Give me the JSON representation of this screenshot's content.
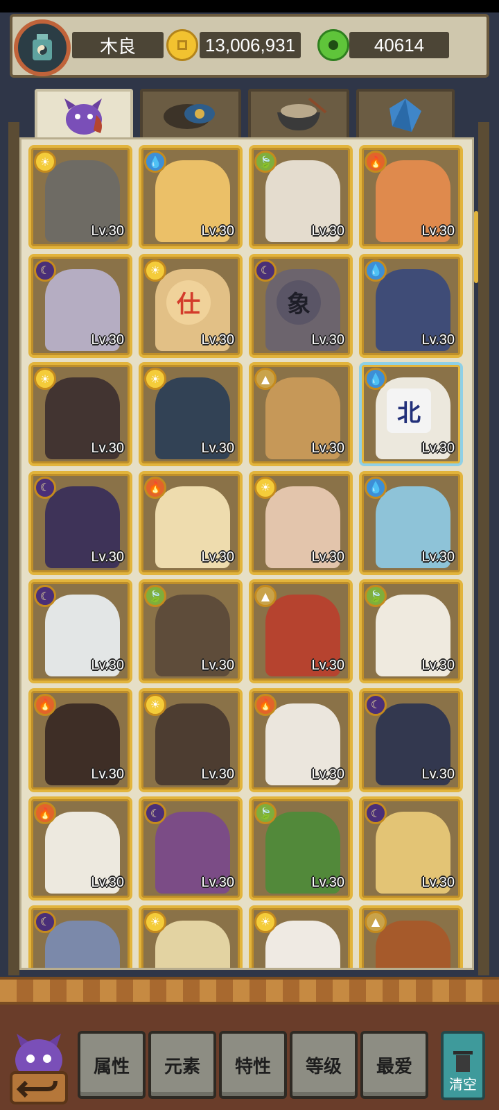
{
  "header": {
    "player_name": "木良",
    "gold": "13,006,931",
    "jade": "40614"
  },
  "tabs": [
    {
      "icon": "demon-icon",
      "active": true
    },
    {
      "icon": "disc-icon",
      "active": false
    },
    {
      "icon": "food-bowl-icon",
      "active": false
    },
    {
      "icon": "crystal-icon",
      "active": false
    }
  ],
  "cards": [
    {
      "level": "Lv.30",
      "element": "sun"
    },
    {
      "level": "Lv.30",
      "element": "water"
    },
    {
      "level": "Lv.30",
      "element": "leaf"
    },
    {
      "level": "Lv.30",
      "element": "fire"
    },
    {
      "level": "Lv.30",
      "element": "moon"
    },
    {
      "level": "Lv.30",
      "element": "sun"
    },
    {
      "level": "Lv.30",
      "element": "moon"
    },
    {
      "level": "Lv.30",
      "element": "water"
    },
    {
      "level": "Lv.30",
      "element": "sun"
    },
    {
      "level": "Lv.30",
      "element": "sun"
    },
    {
      "level": "Lv.30",
      "element": "earth"
    },
    {
      "level": "Lv.30",
      "element": "water"
    },
    {
      "level": "Lv.30",
      "element": "moon"
    },
    {
      "level": "Lv.30",
      "element": "fire"
    },
    {
      "level": "Lv.30",
      "element": "sun"
    },
    {
      "level": "Lv.30",
      "element": "water"
    },
    {
      "level": "Lv.30",
      "element": "moon"
    },
    {
      "level": "Lv.30",
      "element": "leaf"
    },
    {
      "level": "Lv.30",
      "element": "earth"
    },
    {
      "level": "Lv.30",
      "element": "leaf"
    },
    {
      "level": "Lv.30",
      "element": "fire"
    },
    {
      "level": "Lv.30",
      "element": "sun"
    },
    {
      "level": "Lv.30",
      "element": "fire"
    },
    {
      "level": "Lv.30",
      "element": "moon"
    },
    {
      "level": "Lv.30",
      "element": "fire"
    },
    {
      "level": "Lv.30",
      "element": "moon"
    },
    {
      "level": "Lv.30",
      "element": "leaf"
    },
    {
      "level": "Lv.30",
      "element": "moon"
    },
    {
      "level": "",
      "element": "moon"
    },
    {
      "level": "",
      "element": "sun"
    },
    {
      "level": "",
      "element": "sun"
    },
    {
      "level": "",
      "element": "earth"
    }
  ],
  "card_text": {
    "tile_north": "北",
    "chess_shi": "仕",
    "chess_xiang": "象"
  },
  "sort_buttons": [
    {
      "label": "属性"
    },
    {
      "label": "元素"
    },
    {
      "label": "特性"
    },
    {
      "label": "等级"
    },
    {
      "label": "最爱"
    }
  ],
  "clear_label": "清空",
  "colors": {
    "card_gold": "#e2b43c",
    "panel_bg": "#e6dfc6",
    "sun": "#f4cc3a",
    "water": "#3d8fd6",
    "leaf": "#7fae3c",
    "fire": "#e2642a",
    "moon": "#4a2f78",
    "earth": "#c9a34a"
  }
}
